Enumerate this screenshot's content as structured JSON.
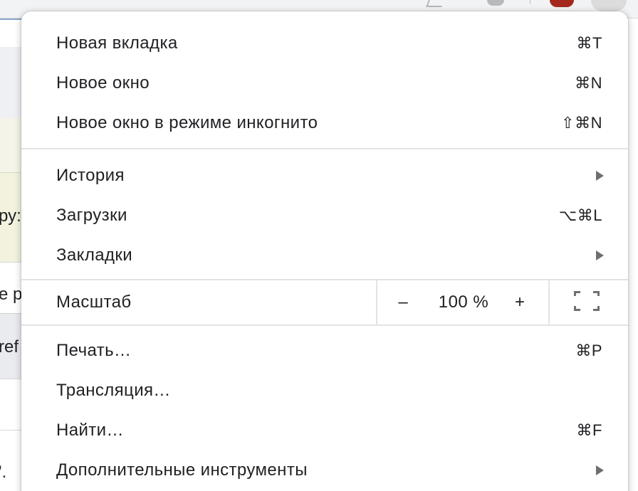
{
  "background_page": {
    "snippets": [
      "ру:",
      "e p",
      "ref",
      "'."
    ]
  },
  "menu": {
    "groups": [
      [
        {
          "label": "Новая вкладка",
          "shortcut": "⌘T"
        },
        {
          "label": "Новое окно",
          "shortcut": "⌘N"
        },
        {
          "label": "Новое окно в режиме инкогнито",
          "shortcut": "⇧⌘N"
        }
      ],
      [
        {
          "label": "История",
          "submenu": true
        },
        {
          "label": "Загрузки",
          "shortcut": "⌥⌘L"
        },
        {
          "label": "Закладки",
          "submenu": true
        }
      ]
    ],
    "zoom": {
      "label": "Масштаб",
      "minus": "–",
      "value": "100 %",
      "plus": "+"
    },
    "tail": [
      {
        "label": "Печать…",
        "shortcut": "⌘P"
      },
      {
        "label": "Трансляция…"
      },
      {
        "label": "Найти…",
        "shortcut": "⌘F"
      },
      {
        "label": "Дополнительные инструменты",
        "submenu": true
      }
    ]
  }
}
